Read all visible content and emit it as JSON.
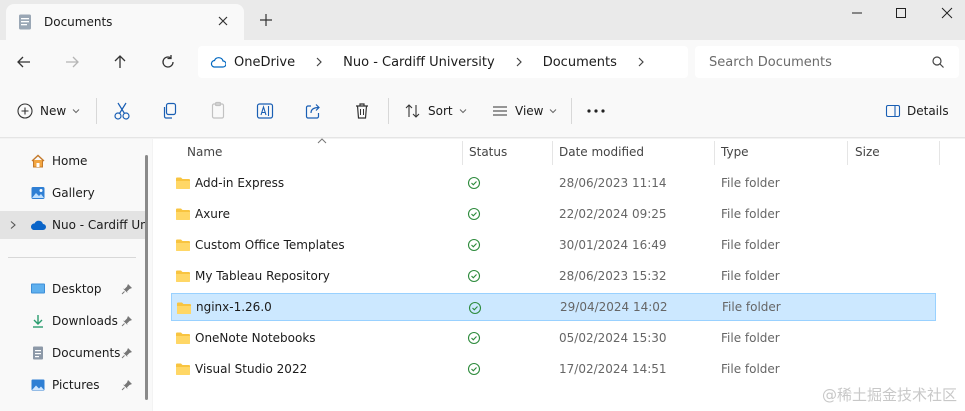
{
  "window": {
    "tab_title": "Documents",
    "controls": [
      "minimize-icon",
      "maximize-icon",
      "close-icon"
    ]
  },
  "breadcrumb": [
    "OneDrive",
    "Nuo - Cardiff University",
    "Documents"
  ],
  "search": {
    "placeholder": "Search Documents"
  },
  "toolbar": {
    "new_label": "New",
    "sort_label": "Sort",
    "view_label": "View",
    "details_label": "Details"
  },
  "nav": {
    "items": [
      {
        "label": "Home",
        "icon": "home-icon"
      },
      {
        "label": "Gallery",
        "icon": "gallery-icon"
      },
      {
        "label": "Nuo - Cardiff University",
        "icon": "onedrive-cloud-icon"
      },
      {
        "label": "Desktop",
        "icon": "desktop-icon"
      },
      {
        "label": "Downloads",
        "icon": "downloads-icon"
      },
      {
        "label": "Documents",
        "icon": "documents-icon"
      },
      {
        "label": "Pictures",
        "icon": "pictures-icon"
      }
    ]
  },
  "columns": {
    "name": "Name",
    "status": "Status",
    "date": "Date modified",
    "type": "Type",
    "size": "Size"
  },
  "files": [
    {
      "name": "Add-in Express",
      "date": "28/06/2023 11:14",
      "type": "File folder"
    },
    {
      "name": "Axure",
      "date": "22/02/2024 09:25",
      "type": "File folder"
    },
    {
      "name": "Custom Office Templates",
      "date": "30/01/2024 16:49",
      "type": "File folder"
    },
    {
      "name": "My Tableau Repository",
      "date": "28/06/2023 15:32",
      "type": "File folder"
    },
    {
      "name": "nginx-1.26.0",
      "date": "29/04/2024 14:02",
      "type": "File folder"
    },
    {
      "name": "OneNote Notebooks",
      "date": "05/02/2024 15:30",
      "type": "File folder"
    },
    {
      "name": "Visual Studio 2022",
      "date": "17/02/2024 14:51",
      "type": "File folder"
    }
  ],
  "colors": {
    "accent": "#0067c0",
    "selection": "#cce8ff",
    "folder": "#f8c440",
    "status_ok": "#2e8b3d"
  },
  "watermark": "@稀土掘金技术社区"
}
